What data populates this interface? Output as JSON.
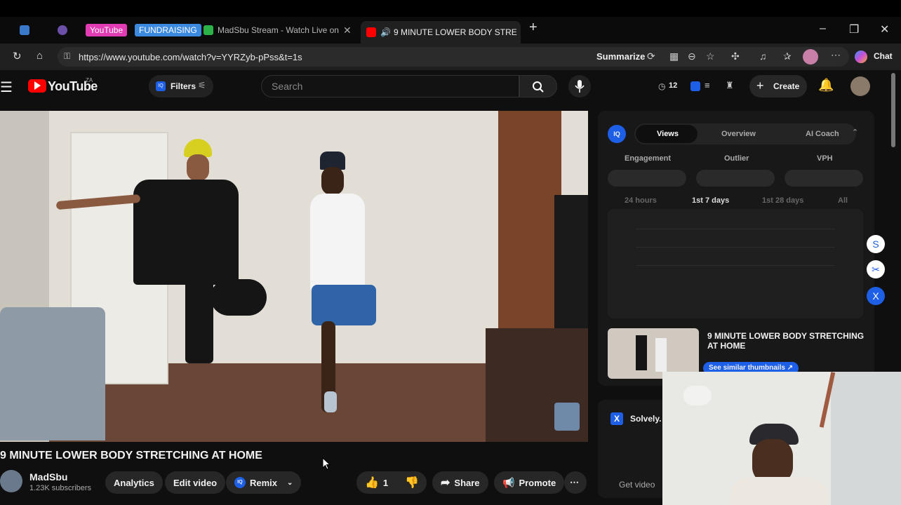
{
  "browser": {
    "tabs": [
      {
        "label": "YouTube"
      },
      {
        "label": "FUNDRAISING"
      },
      {
        "label": "MadSbu Stream - Watch Live on"
      },
      {
        "label": "9 MINUTE LOWER BODY STRE"
      }
    ],
    "url": "https://www.youtube.com/watch?v=YYRZyb-pPss&t=1s",
    "summarize_label": "Summarize",
    "chat_label": "Chat"
  },
  "youtube": {
    "logo_text": "YouTube",
    "country_code": "ZA",
    "filters_label": "Filters",
    "search_placeholder": "Search",
    "streak_count": "12",
    "create_label": "Create"
  },
  "video": {
    "title": "9 MINUTE LOWER BODY STRETCHING AT HOME",
    "channel_name": "MadSbu",
    "subscribers": "1.23K subscribers",
    "analytics_label": "Analytics",
    "edit_label": "Edit video",
    "remix_label": "Remix",
    "like_count": "1",
    "share_label": "Share",
    "promote_label": "Promote"
  },
  "panel": {
    "tabs": [
      "Views",
      "Overview",
      "AI Coach"
    ],
    "metrics": [
      "Engagement",
      "Outlier",
      "VPH"
    ],
    "ranges": [
      "24 hours",
      "1st 7 days",
      "1st 28 days",
      "All"
    ],
    "related_title": "9 MINUTE LOWER BODY STRETCHING AT HOME",
    "similar_label": "See similar thumbnails",
    "solvely_label": "Solvely.",
    "get_video_label": "Get video"
  },
  "colors": {
    "accent": "#ff0000",
    "iq_blue": "#1d5fe6"
  }
}
